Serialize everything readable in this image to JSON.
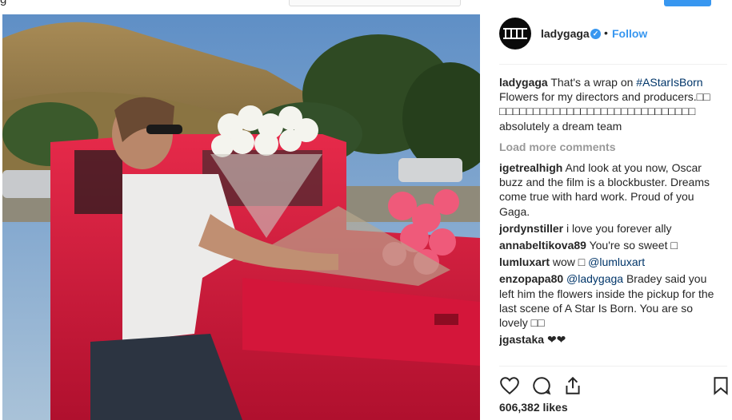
{
  "top_fragment_left": "g",
  "header": {
    "username": "ladygaga",
    "verified_icon": "verified-badge-icon",
    "separator": "•",
    "follow_label": "Follow"
  },
  "caption": {
    "username": "ladygaga",
    "text_before": "That's a wrap on ",
    "hashtag": "#AStarIsBorn",
    "text_after": " Flowers for my directors and producers.□□ □□□□□□□□□□□□□□□□□□□□□□□□□□□□□ absolutely a dream team"
  },
  "load_more": "Load more comments",
  "comments": [
    {
      "user": "igetrealhigh",
      "text": "And look at you now, Oscar buzz and the film is a blockbuster. Dreams come true with hard work. Proud of you Gaga."
    },
    {
      "user": "jordynstiller",
      "text": "i love you forever ally"
    },
    {
      "user": "annabeltikova89",
      "text": "You're so sweet □"
    },
    {
      "user": "lumluxart",
      "text_before": "wow □ ",
      "mention": "@lumluxart",
      "text_after": ""
    },
    {
      "user": "enzopapa80",
      "mention": "@ladygaga",
      "text": " Bradey said you left him the flowers inside the pickup for the last scene of A Star Is Born. You are so lovely □□"
    },
    {
      "user": "jgastaka",
      "text": "❤❤"
    }
  ],
  "actions": {
    "like_icon": "heart-icon",
    "comment_icon": "comment-bubble-icon",
    "share_icon": "share-icon",
    "save_icon": "bookmark-icon"
  },
  "likes": "606,382 likes",
  "colors": {
    "accent": "#3897f0",
    "hashtag": "#003569",
    "muted": "#999999",
    "text": "#262626"
  }
}
